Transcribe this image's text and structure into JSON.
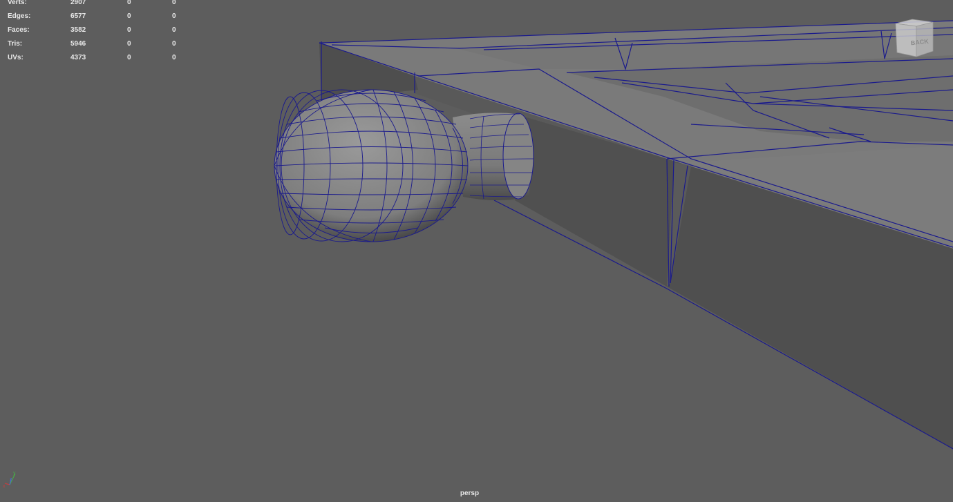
{
  "hud": {
    "rows": [
      {
        "label": "Verts:",
        "value": "2907",
        "c1": "0",
        "c2": "0"
      },
      {
        "label": "Edges:",
        "value": "6577",
        "c1": "0",
        "c2": "0"
      },
      {
        "label": "Faces:",
        "value": "3582",
        "c1": "0",
        "c2": "0"
      },
      {
        "label": "Tris:",
        "value": "5946",
        "c1": "0",
        "c2": "0"
      },
      {
        "label": "UVs:",
        "value": "4373",
        "c1": "0",
        "c2": "0"
      }
    ]
  },
  "viewcube": {
    "face_label": "BACK"
  },
  "camera": {
    "name": "persp"
  },
  "axis": {
    "x": "x",
    "y": "y",
    "z": "z"
  },
  "colors": {
    "background": "#5d5d5d",
    "wireframe": "#1a1a8c",
    "hud_text": "#e8e8e8"
  }
}
